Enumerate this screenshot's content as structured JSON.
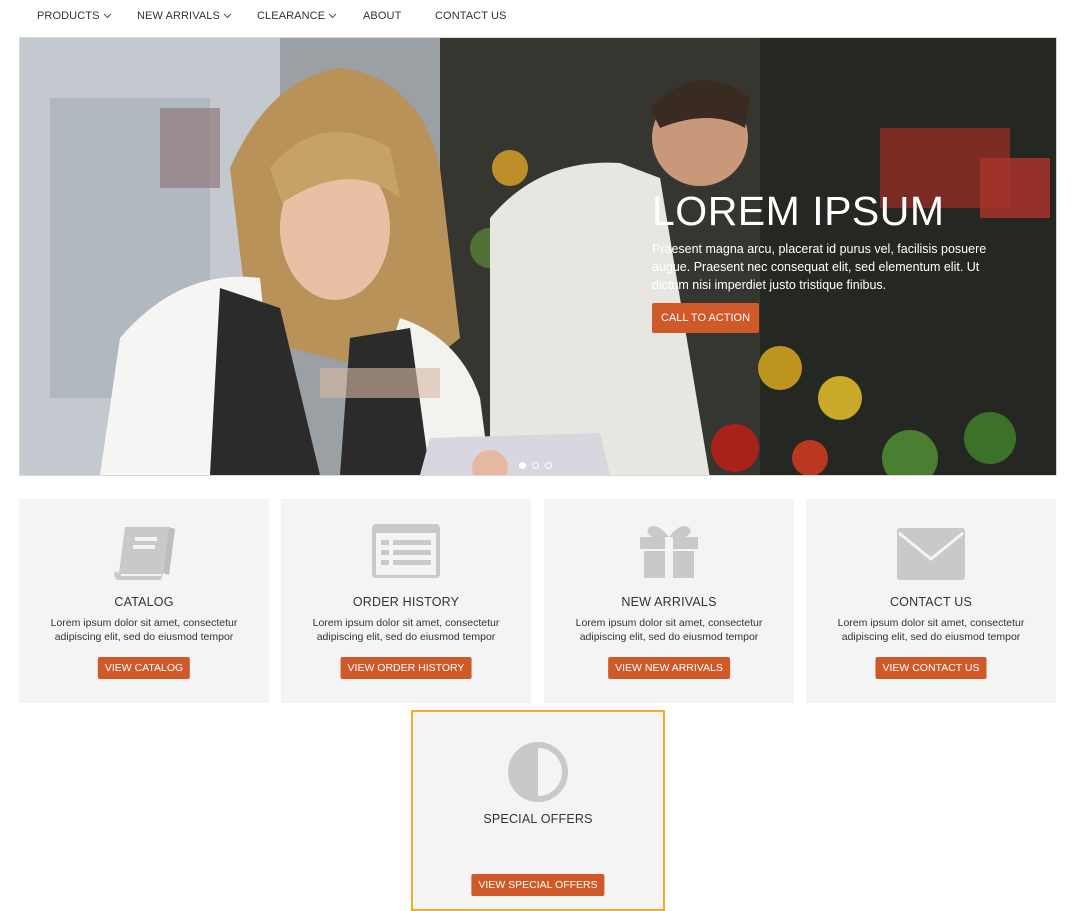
{
  "nav": {
    "items": [
      {
        "label": "PRODUCTS",
        "has_dropdown": true
      },
      {
        "label": "NEW ARRIVALS",
        "has_dropdown": true
      },
      {
        "label": "CLEARANCE",
        "has_dropdown": true
      },
      {
        "label": "ABOUT",
        "has_dropdown": false
      },
      {
        "label": "CONTACT US",
        "has_dropdown": false
      }
    ]
  },
  "hero": {
    "title": "LOREM IPSUM",
    "text": "Praesent magna arcu, placerat id purus vel, facilisis posuere augue. Praesent nec consequat elit, sed elementum elit. Ut dictum nisi imperdiet justo tristique finibus.",
    "cta_label": "CALL TO ACTION",
    "slides_count": 3,
    "active_slide": 1
  },
  "cards": [
    {
      "icon": "book-icon",
      "title": "CATALOG",
      "description": "Lorem ipsum dolor sit amet, consectetur adipiscing elit, sed do eiusmod tempor",
      "button": "VIEW CATALOG"
    },
    {
      "icon": "list-icon",
      "title": "ORDER HISTORY",
      "description": "Lorem ipsum dolor sit amet, consectetur adipiscing elit, sed do eiusmod tempor",
      "button": "VIEW ORDER HISTORY"
    },
    {
      "icon": "gift-icon",
      "title": "NEW ARRIVALS",
      "description": "Lorem ipsum dolor sit amet, consectetur adipiscing elit, sed do eiusmod tempor",
      "button": "VIEW NEW ARRIVALS"
    },
    {
      "icon": "envelope-icon",
      "title": "CONTACT US",
      "description": "Lorem ipsum dolor sit amet, consectetur adipiscing elit, sed do eiusmod tempor",
      "button": "VIEW CONTACT US"
    }
  ],
  "special": {
    "icon": "half-circle-icon",
    "title": "SPECIAL OFFERS",
    "button": "VIEW SPECIAL OFFERS"
  },
  "colors": {
    "accent": "#d0592a",
    "highlight_border": "#f0ad25",
    "card_bg": "#f4f4f4",
    "icon_gray": "#c9c9c9"
  }
}
